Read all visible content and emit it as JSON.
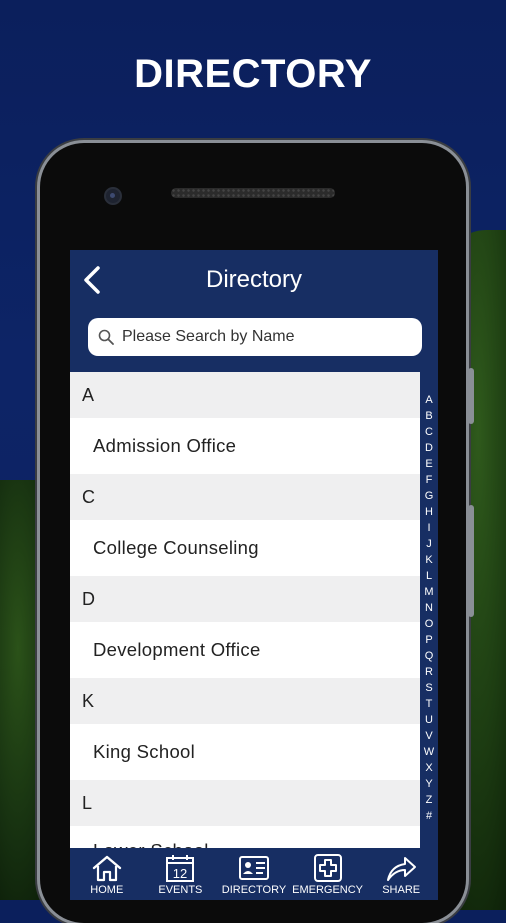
{
  "headline": "DIRECTORY",
  "appbar": {
    "back_icon": "chevron-left-icon",
    "title": "Directory"
  },
  "search": {
    "placeholder": "Please Search by Name",
    "icon": "search-icon"
  },
  "sections": [
    {
      "letter": "A",
      "items": [
        "Admission Office"
      ]
    },
    {
      "letter": "C",
      "items": [
        "College Counseling"
      ]
    },
    {
      "letter": "D",
      "items": [
        "Development Office"
      ]
    },
    {
      "letter": "K",
      "items": [
        "King School"
      ]
    },
    {
      "letter": "L",
      "items": [
        "Lower School"
      ]
    }
  ],
  "index_letters": [
    "A",
    "B",
    "C",
    "D",
    "E",
    "F",
    "G",
    "H",
    "I",
    "J",
    "K",
    "L",
    "M",
    "N",
    "O",
    "P",
    "Q",
    "R",
    "S",
    "T",
    "U",
    "V",
    "W",
    "X",
    "Y",
    "Z",
    "#"
  ],
  "tabs": [
    {
      "label": "HOME",
      "icon": "home-icon"
    },
    {
      "label": "EVENTS",
      "icon": "calendar-icon",
      "icon_text": "12"
    },
    {
      "label": "DIRECTORY",
      "icon": "contact-card-icon"
    },
    {
      "label": "EMERGENCY",
      "icon": "medical-cross-icon"
    },
    {
      "label": "SHARE",
      "icon": "share-arrow-icon"
    }
  ],
  "colors": {
    "navy": "#172e63",
    "background": "#0b1f5c",
    "section_bg": "#efeff0"
  }
}
